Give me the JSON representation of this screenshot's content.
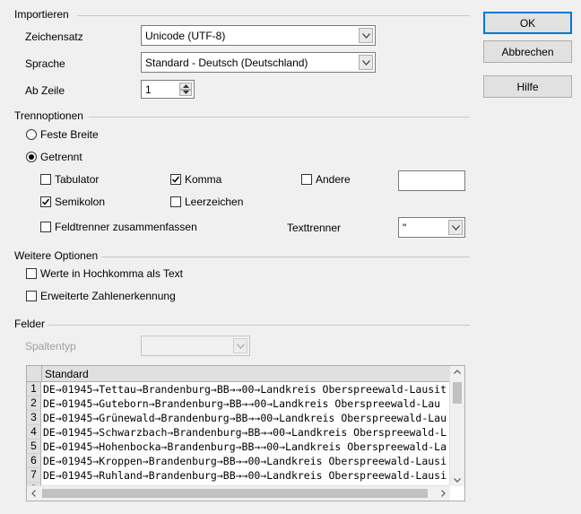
{
  "import_section": {
    "title": "Importieren",
    "charset_label": "Zeichensatz",
    "charset_value": "Unicode (UTF-8)",
    "language_label": "Sprache",
    "language_value": "Standard - Deutsch (Deutschland)",
    "from_row_label": "Ab Zeile",
    "from_row_value": "1"
  },
  "separator_section": {
    "title": "Trennoptionen",
    "fixed_width_label": "Feste Breite",
    "separated_label": "Getrennt",
    "selected_mode": "separated",
    "tab_label": "Tabulator",
    "tab_checked": false,
    "comma_label": "Komma",
    "comma_checked": true,
    "other_label": "Andere",
    "other_checked": false,
    "other_value": "",
    "semicolon_label": "Semikolon",
    "semicolon_checked": true,
    "space_label": "Leerzeichen",
    "space_checked": false,
    "merge_label": "Feldtrenner zusammenfassen",
    "merge_checked": false,
    "string_delim_label": "Texttrenner",
    "string_delim_value": "\""
  },
  "other_options": {
    "title": "Weitere Optionen",
    "quoted_as_text_label": "Werte in Hochkomma als Text",
    "quoted_as_text_checked": false,
    "detect_special_label": "Erweiterte Zahlenerkennung",
    "detect_special_checked": false
  },
  "fields": {
    "title": "Felder",
    "column_type_label": "Spaltentyp",
    "column_type_value": "",
    "column_header": "Standard",
    "rows": [
      {
        "num": "1",
        "text": "DE→01945→Tettau→Brandenburg→BB→→00→Landkreis Oberspreewald-Lausit"
      },
      {
        "num": "2",
        "text": "DE→01945→Guteborn→Brandenburg→BB→→00→Landkreis Oberspreewald-Lau"
      },
      {
        "num": "3",
        "text": "DE→01945→Grünewald→Brandenburg→BB→→00→Landkreis Oberspreewald-Lau"
      },
      {
        "num": "4",
        "text": "DE→01945→Schwarzbach→Brandenburg→BB→→00→Landkreis Oberspreewald-L"
      },
      {
        "num": "5",
        "text": "DE→01945→Hohenbocka→Brandenburg→BB→→00→Landkreis Oberspreewald-La"
      },
      {
        "num": "6",
        "text": "DE→01945→Kroppen→Brandenburg→BB→→00→Landkreis Oberspreewald-Lausi"
      },
      {
        "num": "7",
        "text": "DE→01945→Ruhland→Brandenburg→BB→→00→Landkreis Oberspreewald-Lausi"
      }
    ]
  },
  "buttons": {
    "ok_label": "OK",
    "cancel_label": "Abbrechen",
    "help_label": "Hilfe"
  }
}
